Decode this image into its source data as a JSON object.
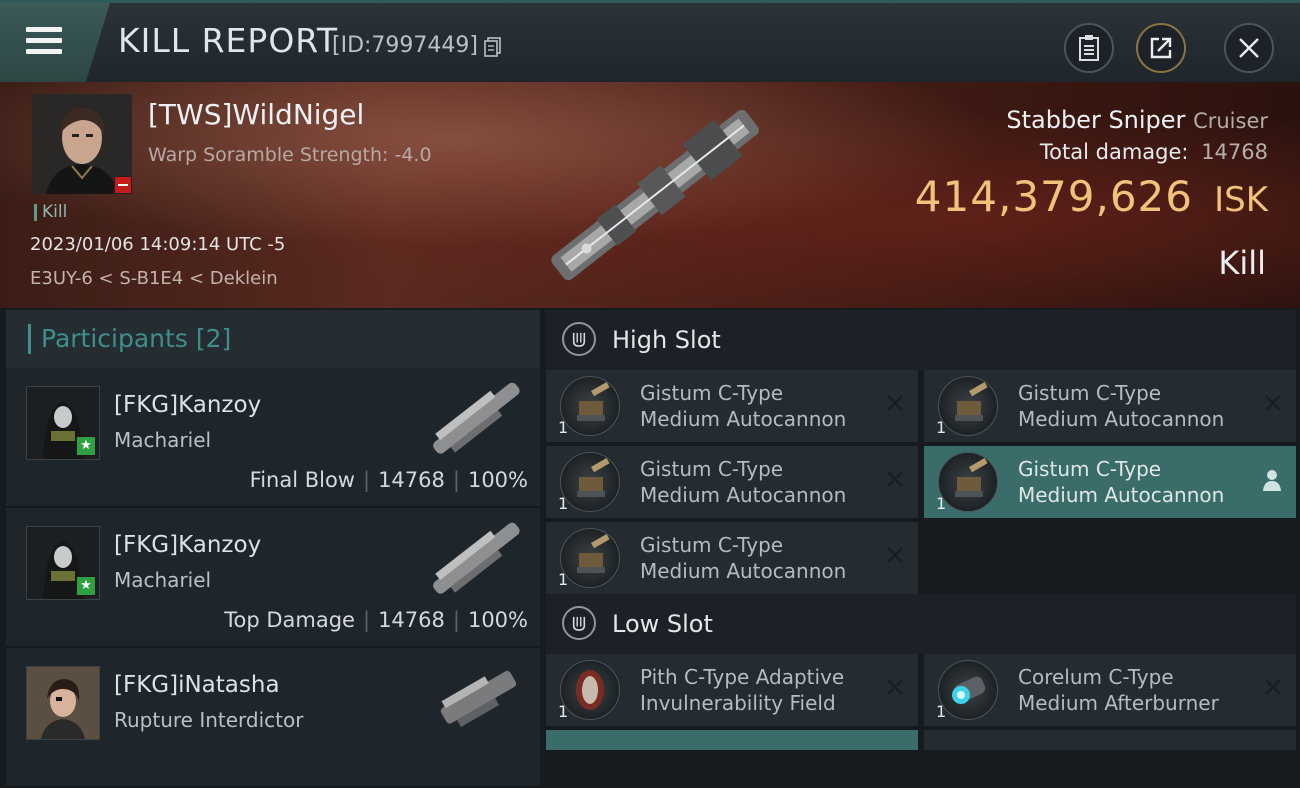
{
  "header": {
    "title": "KILL REPORT",
    "report_id": "[ID:7997449]"
  },
  "victim": {
    "name": "[TWS]WildNigel",
    "warp_scramble": "Warp Soramble Strength: -4.0",
    "kill_tag": "Kill",
    "datetime": "2023/01/06 14:09:14 UTC -5",
    "location": "E3UY-6 < S-B1E4 < Deklein",
    "ship_name": "Stabber Sniper",
    "ship_class": "Cruiser",
    "total_damage_label": "Total damage:",
    "total_damage": "14768",
    "isk_value": "414,379,626",
    "isk_unit": "ISK",
    "result": "Kill"
  },
  "participants": {
    "label": "Participants",
    "count": "[2]",
    "rows": [
      {
        "name": "[FKG]Kanzoy",
        "ship": "Machariel",
        "role": "Final Blow",
        "damage": "14768",
        "percent": "100%"
      },
      {
        "name": "[FKG]Kanzoy",
        "ship": "Machariel",
        "role": "Top Damage",
        "damage": "14768",
        "percent": "100%"
      },
      {
        "name": "[FKG]iNatasha",
        "ship": "Rupture Interdictor",
        "role": "",
        "damage": "",
        "percent": ""
      }
    ]
  },
  "high_slot": {
    "label": "High Slot",
    "items": [
      {
        "line1": "Gistum C-Type",
        "line2": "Medium Autocannon",
        "qty": "1"
      },
      {
        "line1": "Gistum C-Type",
        "line2": "Medium Autocannon",
        "qty": "1"
      },
      {
        "line1": "Gistum C-Type",
        "line2": "Medium Autocannon",
        "qty": "1"
      },
      {
        "line1": "Gistum C-Type",
        "line2": "Medium Autocannon",
        "qty": "1"
      },
      {
        "line1": "Gistum C-Type",
        "line2": "Medium Autocannon",
        "qty": "1"
      }
    ]
  },
  "low_slot": {
    "label": "Low Slot",
    "items": [
      {
        "line1": "Pith C-Type Adaptive",
        "line2": "Invulnerability Field",
        "qty": "1"
      },
      {
        "line1": "Corelum C-Type",
        "line2": "Medium Afterburner",
        "qty": "1"
      }
    ]
  },
  "colors": {
    "accent_teal": "#3e8f8a",
    "isk_gold": "#f0c27b",
    "selected_row": "#3a6c69"
  },
  "icons": [
    "menu-icon",
    "copy-icon",
    "clipboard-icon",
    "share-icon",
    "close-icon",
    "remove-icon",
    "person-icon"
  ]
}
